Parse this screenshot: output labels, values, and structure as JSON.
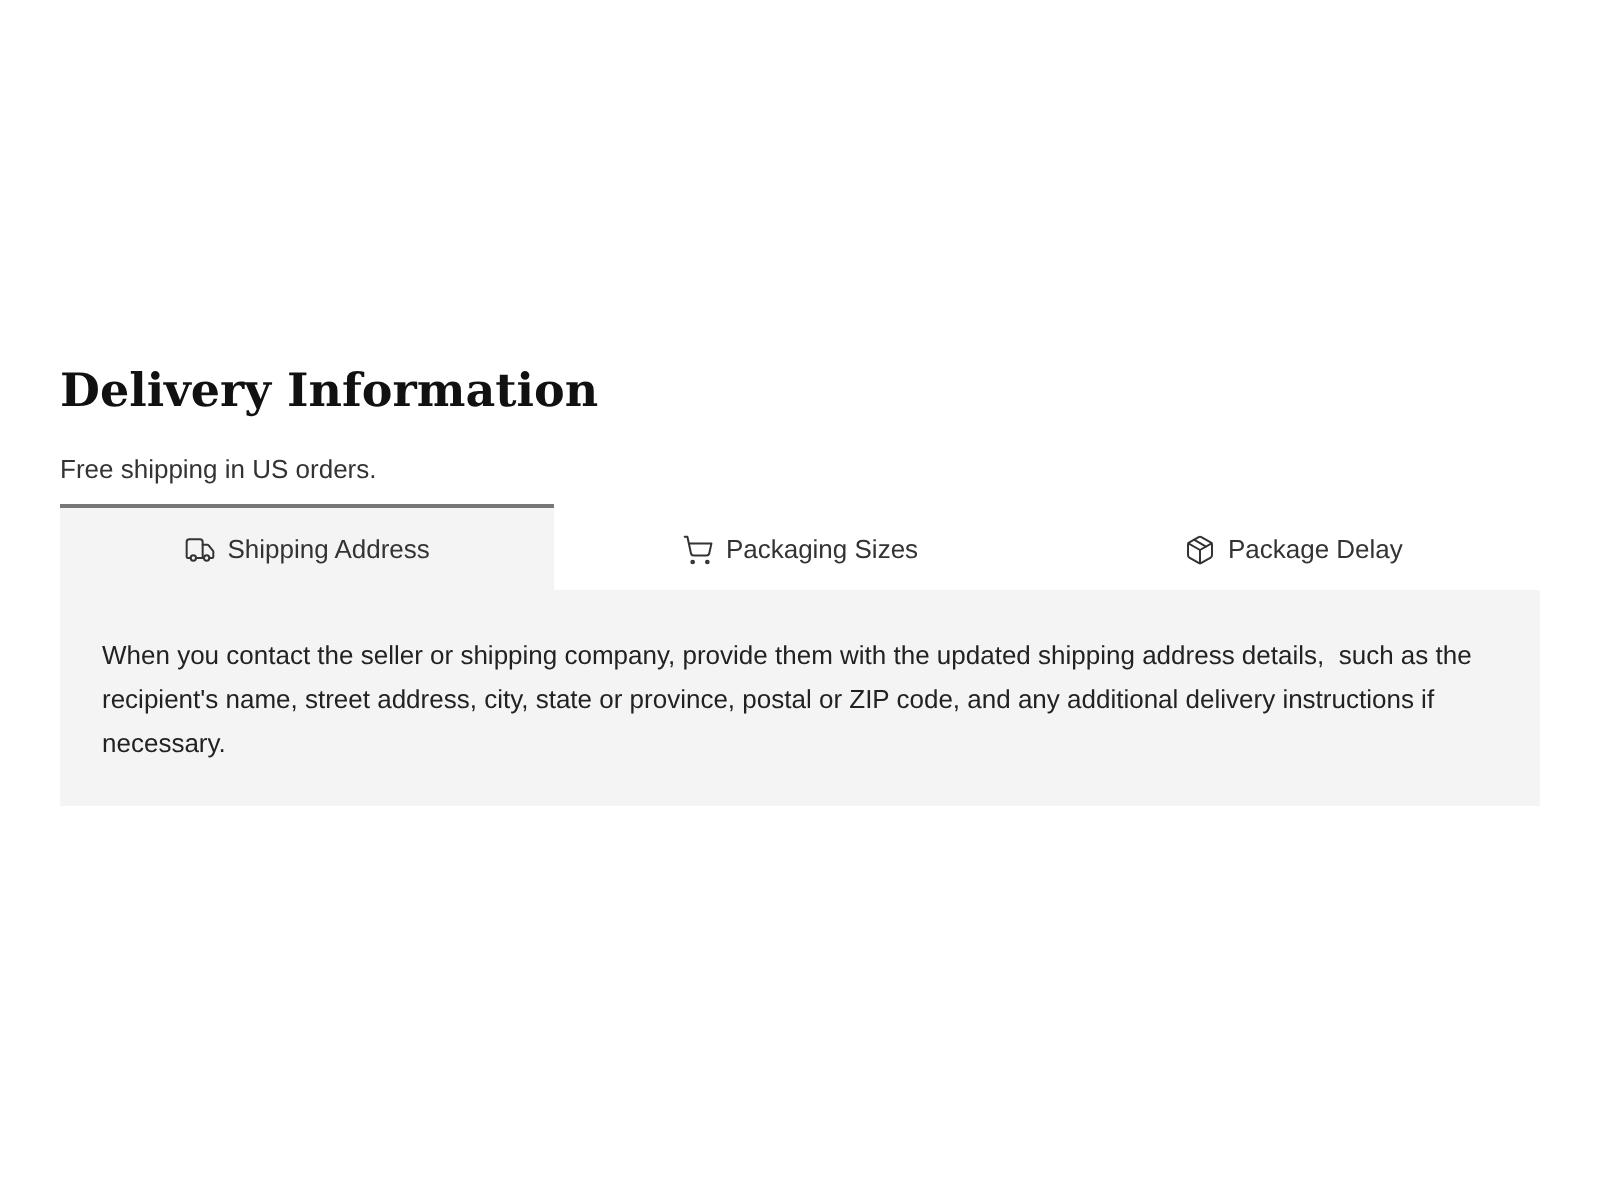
{
  "heading": "Delivery Information",
  "subtitle": "Free shipping in US orders.",
  "tabs": [
    {
      "label": "Shipping Address",
      "selected": true
    },
    {
      "label": "Packaging Sizes",
      "selected": false
    },
    {
      "label": "Package Delay",
      "selected": false
    }
  ],
  "panel": {
    "text": "When you contact the seller or shipping company, provide them with the updated shipping address details,  such as the recipient's name, street address, city, state or province, postal or ZIP code, and any additional delivery instructions if necessary."
  }
}
